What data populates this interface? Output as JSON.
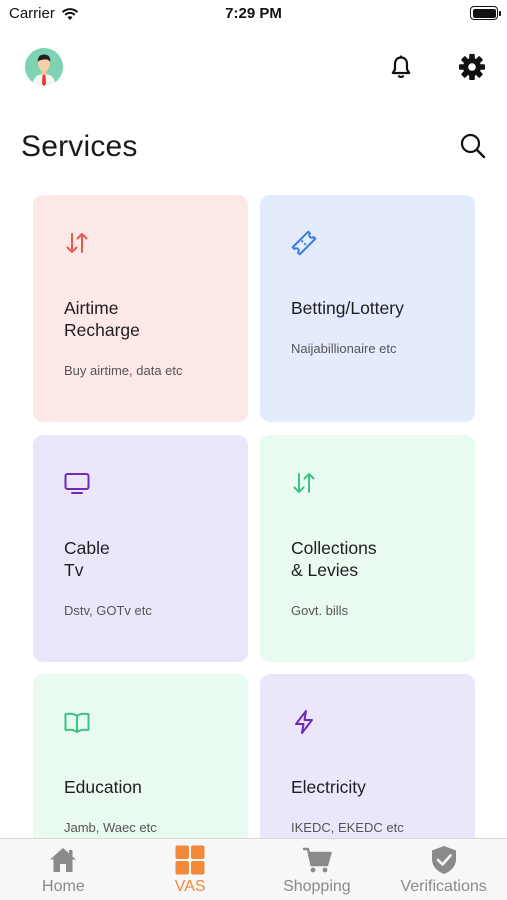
{
  "status_bar": {
    "carrier": "Carrier",
    "time": "7:29 PM"
  },
  "header": {
    "title": "Services"
  },
  "services": [
    {
      "title": "Airtime\nRecharge",
      "subtitle": "Buy airtime, data etc",
      "icon": "transfer-arrows-icon",
      "bg": "#fde8e8",
      "accent": "#e55a4e"
    },
    {
      "title": "Betting/Lottery",
      "subtitle": "Naijabillionaire etc",
      "icon": "ticket-icon",
      "bg": "#e3ebfc",
      "accent": "#3b7be0"
    },
    {
      "title": "Cable\nTv",
      "subtitle": "Dstv, GOTv etc",
      "icon": "tv-icon",
      "bg": "#ece6fb",
      "accent": "#6d2bb5"
    },
    {
      "title": "Collections\n& Levies",
      "subtitle": "Govt. bills",
      "icon": "transfer-arrows-icon",
      "bg": "#e9faf1",
      "accent": "#3cc384"
    },
    {
      "title": "Education",
      "subtitle": "Jamb, Waec etc",
      "icon": "book-icon",
      "bg": "#e9faf1",
      "accent": "#3cc384"
    },
    {
      "title": "Electricity",
      "subtitle": "IKEDC, EKEDC etc",
      "icon": "lightning-icon",
      "bg": "#ece6fb",
      "accent": "#6d2bb5"
    }
  ],
  "tabs": [
    {
      "label": "Home",
      "icon": "home-icon"
    },
    {
      "label": "VAS",
      "icon": "grid-icon",
      "active": true
    },
    {
      "label": "Shopping",
      "icon": "cart-icon"
    },
    {
      "label": "Verifications",
      "icon": "shield-check-icon"
    }
  ],
  "colors": {
    "active_tab": "#f08a3a",
    "inactive_tab": "#8a8a8a"
  }
}
